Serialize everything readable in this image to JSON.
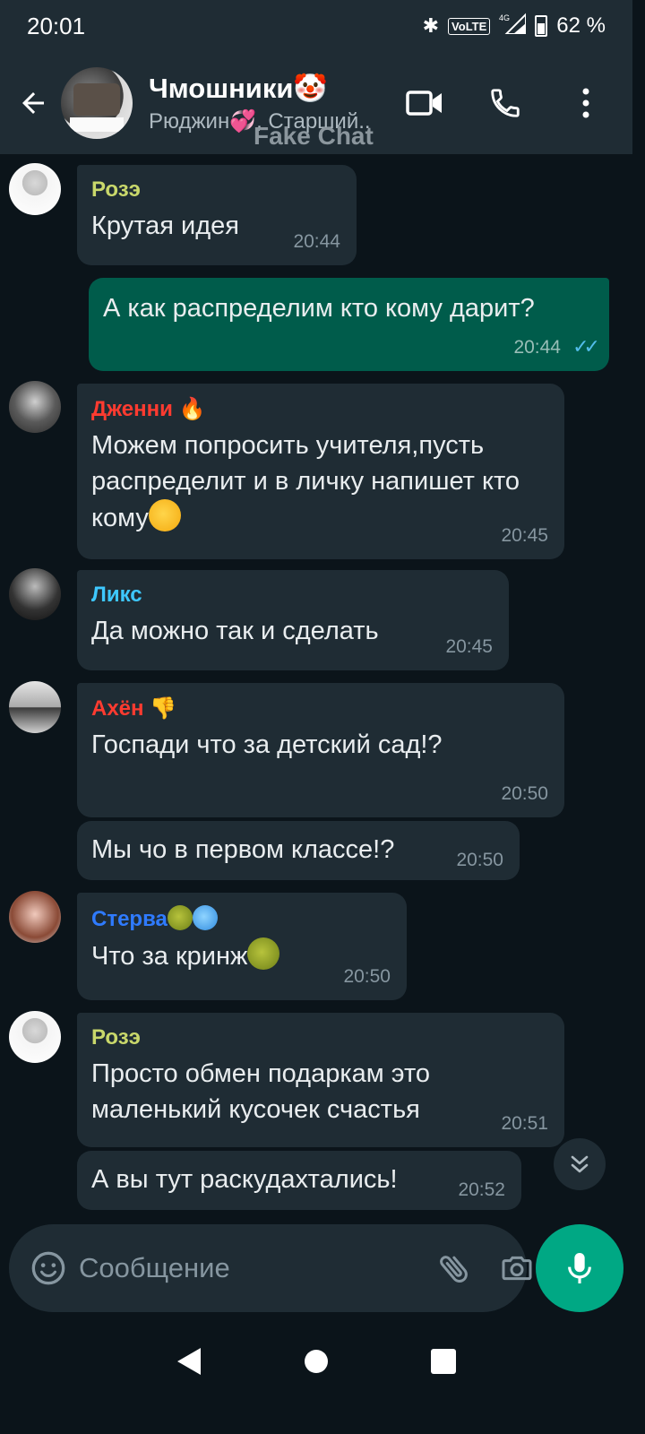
{
  "status": {
    "time": "20:01",
    "network": "VoLTE",
    "signal_label": "4G",
    "battery": "62 %"
  },
  "header": {
    "title": "Чмошники🤡",
    "subtitle": "Рюджин💞, Старший..",
    "watermark": "Fake Chat"
  },
  "messages": [
    {
      "sender": "Розэ",
      "sender_color": "#c9d86b",
      "text": "Крутая идея",
      "time": "20:44"
    },
    {
      "sender": "",
      "text": "А как распределим кто кому дарит?",
      "time": "20:44",
      "outgoing": true,
      "read": true
    },
    {
      "sender": "Дженни",
      "sender_color": "#ff3b30",
      "text": "Можем попросить учителя,пусть распределит  и в личку напишет кто кому",
      "time": "20:45"
    },
    {
      "sender": "Ликс",
      "sender_color": "#3ec8ff",
      "text": "Да можно так и сделать",
      "time": "20:45"
    },
    {
      "sender": "Ахён",
      "sender_color": "#ff3b30",
      "text": "Госпади что за детский сад!?",
      "time": "20:50"
    },
    {
      "sender": "",
      "text": "Мы чо в первом классе!?",
      "time": "20:50"
    },
    {
      "sender": "Стерва",
      "sender_color": "#2f7bff",
      "text": "Что за кринж",
      "time": "20:50"
    },
    {
      "sender": "Розэ",
      "sender_color": "#c9d86b",
      "text": "Просто обмен подаркам это маленький кусочек счастья",
      "time": "20:51"
    },
    {
      "sender": "",
      "text": "А вы тут раскудахтались!",
      "time": "20:52"
    }
  ],
  "input": {
    "placeholder": "Сообщение"
  },
  "colors": {
    "background": "#0b141a",
    "bubble_in": "#1f2c34",
    "bubble_out": "#005c4b",
    "accent": "#00a884",
    "read_ticks": "#53bdeb"
  }
}
